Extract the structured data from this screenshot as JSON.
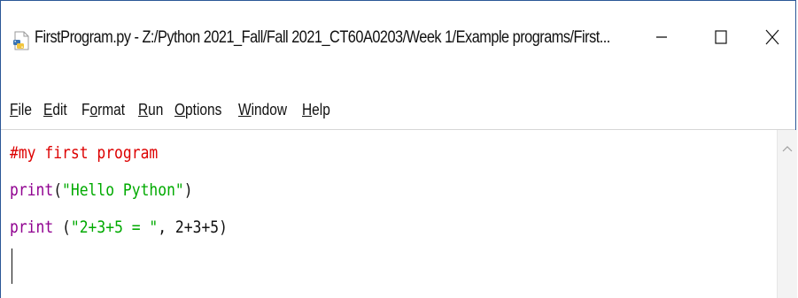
{
  "window": {
    "title": "FirstProgram.py - Z:/Python 2021_Fall/Fall 2021_CT60A0203/Week 1/Example programs/First...",
    "app_icon": "python-file-icon",
    "controls": {
      "minimize_icon": "minimize-icon",
      "maximize_icon": "maximize-icon",
      "close_icon": "close-icon"
    },
    "border_color": "#2b5797"
  },
  "menubar": {
    "items": [
      {
        "label": "File",
        "underline": "F"
      },
      {
        "label": "Edit",
        "underline": "E"
      },
      {
        "label": "Format",
        "underline": "o"
      },
      {
        "label": "Run",
        "underline": "R"
      },
      {
        "label": "Options",
        "underline": "O"
      },
      {
        "label": "Window",
        "underline": "W"
      },
      {
        "label": "Help",
        "underline": "H"
      }
    ]
  },
  "editor": {
    "lines": [
      {
        "tokens": [
          {
            "type": "comment",
            "text": "#my first program"
          }
        ]
      },
      {
        "tokens": [
          {
            "type": "builtin",
            "text": "print"
          },
          {
            "type": "plain",
            "text": "("
          },
          {
            "type": "string",
            "text": "\"Hello Python\""
          },
          {
            "type": "plain",
            "text": ")"
          }
        ]
      },
      {
        "tokens": [
          {
            "type": "builtin",
            "text": "print"
          },
          {
            "type": "plain",
            "text": " ("
          },
          {
            "type": "string",
            "text": "\"2+3+5 = \""
          },
          {
            "type": "plain",
            "text": ", 2+3+5)"
          }
        ]
      }
    ],
    "colors": {
      "comment": "#dd0000",
      "builtin": "#900090",
      "string": "#00aa00",
      "plain": "#111111"
    }
  },
  "scrollbar": {
    "up_icon": "scroll-up-arrow-icon"
  }
}
